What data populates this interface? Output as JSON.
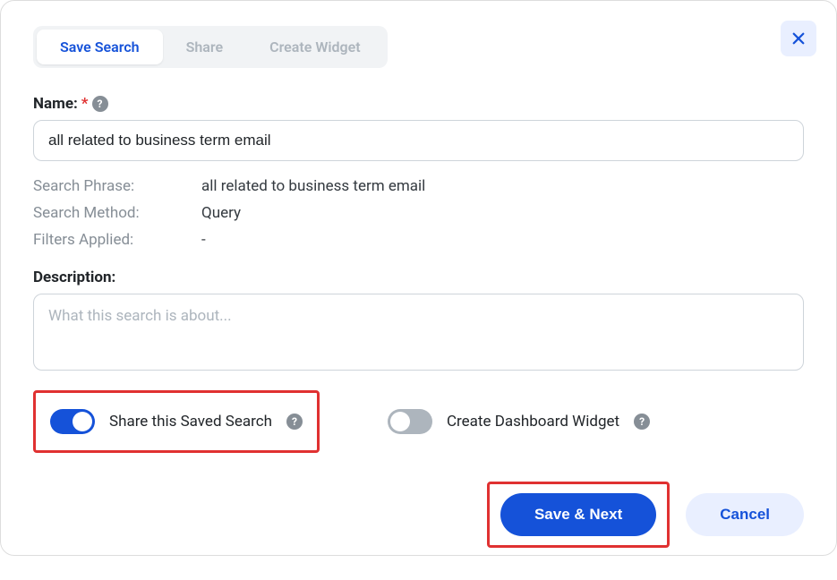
{
  "tabs": {
    "save_search": "Save Search",
    "share": "Share",
    "create_widget": "Create Widget"
  },
  "form": {
    "name_label": "Name:",
    "name_value": "all related to business term email",
    "description_label": "Description:",
    "description_placeholder": "What this search is about..."
  },
  "info": {
    "search_phrase_label": "Search Phrase:",
    "search_phrase_value": "all related to business term email",
    "search_method_label": "Search Method:",
    "search_method_value": "Query",
    "filters_applied_label": "Filters Applied:",
    "filters_applied_value": "-"
  },
  "toggles": {
    "share_label": "Share this Saved Search",
    "widget_label": "Create Dashboard Widget"
  },
  "buttons": {
    "save_next": "Save & Next",
    "cancel": "Cancel"
  }
}
